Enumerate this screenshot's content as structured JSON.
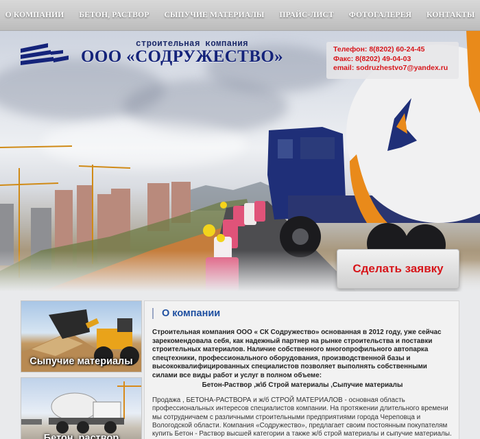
{
  "nav": {
    "items": [
      "О КОМПАНИИ",
      "БЕТОН, РАСТВОР",
      "СЫПУЧИЕ МАТЕРИАЛЫ",
      "ПРАЙС-ЛИСТ",
      "ФОТОГАЛЕРЕЯ",
      "КОНТАКТЫ"
    ]
  },
  "header": {
    "tagline": "строительная компания",
    "company_name": "ООО «СОДРУЖЕСТВО»"
  },
  "contacts": {
    "phone": "Телефон: 8(8202) 60-24-45",
    "fax": "Факс: 8(8202) 49-04-03",
    "email": "email: sodruzhestvo7@yandex.ru"
  },
  "hero": {
    "order_button": "Сделать заявку"
  },
  "promos": [
    {
      "label": "Сыпучие материалы"
    },
    {
      "label": "Бетон, раствор"
    }
  ],
  "about": {
    "title": "О компании",
    "intro": "Строительная компания ООО « СК Содружество» основанная в 2012 году, уже сейчас зарекомендовала себя, как надежный партнер на рынке строительства и поставки строительных материалов. Наличие собственного многопрофильного автопарка спецтехники, профессионального оборудования, производственной базы и высококвалифицированных специалистов позволяет выполнять собственными силами все виды работ и услуг в полном объеме:",
    "products": "Бетон-Раствор ,ж\\б Строй материалы ,Сыпучие материалы",
    "body": "Продажа , БЕТОНА-РАСТВОРА и ж/б  СТРОЙ МАТЕРИАЛОВ - основная область профессиональных интересов специалистов компании. На протяжении длительного времени мы сотрудничаем с различными строительными предприятиями города Череповца и Вологодской области. Компания «Содружество», предлагает своим постоянным покупателям купить Бетон - Раствор  высшей категории а также ж/б строй материалы и сыпучие материалы."
  },
  "colors": {
    "accent_red": "#d7151a",
    "brand_blue": "#14237a",
    "title_blue": "#1e4fa0"
  }
}
